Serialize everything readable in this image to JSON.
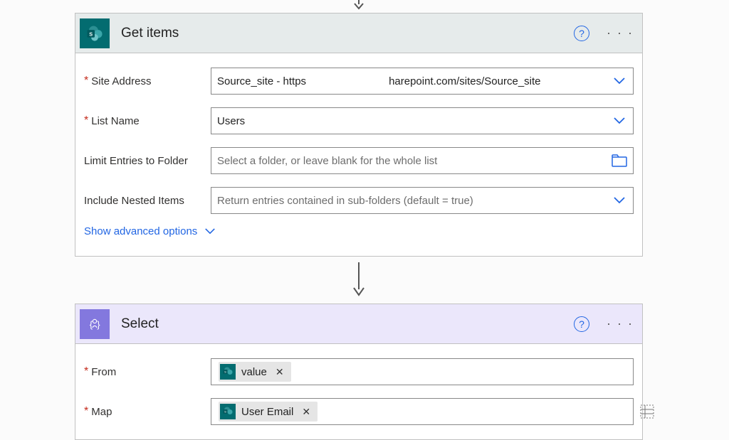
{
  "connector_top": {
    "visible": true
  },
  "card1": {
    "title": "Get items",
    "fields": {
      "siteAddress": {
        "label": "Site Address",
        "required": true,
        "value_prefix": "Source_site - https",
        "value_suffix": "harepoint.com/sites/Source_site"
      },
      "listName": {
        "label": "List Name",
        "required": true,
        "value": "Users"
      },
      "limitFolder": {
        "label": "Limit Entries to Folder",
        "required": false,
        "placeholder": "Select a folder, or leave blank for the whole list"
      },
      "nested": {
        "label": "Include Nested Items",
        "required": false,
        "placeholder": "Return entries contained in sub-folders (default = true)"
      }
    },
    "advanced": "Show advanced options"
  },
  "card2": {
    "title": "Select",
    "fields": {
      "from": {
        "label": "From",
        "required": true,
        "token": "value"
      },
      "map": {
        "label": "Map",
        "required": true,
        "token": "User Email"
      }
    }
  },
  "icons": {
    "help": "?",
    "more": "· · ·",
    "close_x": "✕"
  }
}
